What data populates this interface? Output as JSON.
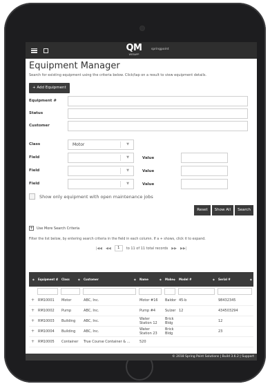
{
  "header": {
    "logo_main": "QM",
    "logo_sub": "WEBAPP",
    "brand": "springpoint"
  },
  "page": {
    "title": "Equipment Manager",
    "subtitle": "Search for existing equipment using the criteria below. Click/tap on a result to view equipment details.",
    "add_button": "+ Add Equipment"
  },
  "form": {
    "equipment_label": "Equipment #",
    "status_label": "Status",
    "customer_label": "Customer",
    "class_label": "Class",
    "class_value": "Motor",
    "field_label": "Field",
    "value_label": "Value",
    "open_jobs_label": "Show only equipment with open maintenance jobs"
  },
  "buttons": {
    "reset": "Reset",
    "show_all": "Show All",
    "search": "Search"
  },
  "more_criteria": "Use More Search Criteria",
  "instructions": "Filter the list below, by entering search criteria in the field in each column. If a + shows, click it to expand.",
  "pager": {
    "first": "|◀◀",
    "prev": "◀◀",
    "page": "1",
    "info": "to 11 of 11 total records",
    "next": "▶▶",
    "last": "▶▶|"
  },
  "grid": {
    "columns": [
      "Equipment #",
      "Class",
      "Customer",
      "Name",
      "Make",
      "Model #",
      "Serial #"
    ],
    "rows": [
      [
        "+",
        "RM10001",
        "Motor",
        "ABC, Inc.",
        "Motor #16",
        "Baldor",
        "45-b",
        "98432345"
      ],
      [
        "+",
        "RM10002",
        "Pump",
        "ABC, Inc.",
        "Pump #4",
        "Sulzer",
        "12",
        "434503294"
      ],
      [
        "+",
        "RM10003",
        "Building",
        "ABC, Inc.",
        "Water Station 12",
        "Brick Bldg",
        "",
        "12"
      ],
      [
        "+",
        "RM10004",
        "Building",
        "ABC, Inc.",
        "Water Station 23",
        "Brick Bldg",
        "",
        "23"
      ],
      [
        "+",
        "RM10005",
        "Container",
        "True Course Container & ...",
        "520",
        "",
        "",
        ""
      ]
    ]
  },
  "footer": "© 2018 Spring Point Solutions  |  Build 3.6.2  |  Support"
}
